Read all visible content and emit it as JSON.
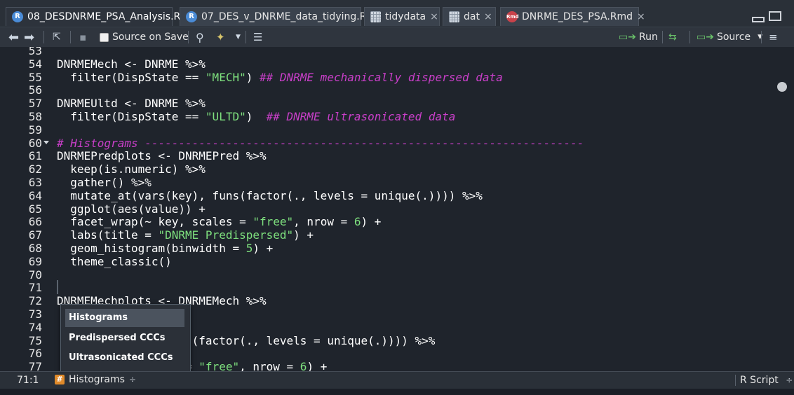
{
  "tabs": [
    {
      "label": "08_DESDNRME_PSA_Analysis.R",
      "icon": "r-script-icon",
      "active": true
    },
    {
      "label": "07_DES_v_DNRME_data_tidying.R",
      "icon": "r-script-icon",
      "active": false
    },
    {
      "label": "tidydata",
      "icon": "data-table-icon",
      "active": false
    },
    {
      "label": "dat",
      "icon": "data-table-icon",
      "active": false
    },
    {
      "label": "DNRME_DES_PSA.Rmd",
      "icon": "rmarkdown-icon",
      "active": false
    }
  ],
  "tab_close_glyph": "×",
  "toolbar": {
    "source_on_save_label": "Source on Save",
    "run_label": "Run",
    "source_label": "Source"
  },
  "editor": {
    "lines": [
      {
        "n": "53",
        "code": ""
      },
      {
        "n": "54",
        "code": "DNRMEMech <- DNRME %>%"
      },
      {
        "n": "55",
        "code": "  filter(DispState == ",
        "str": "\"MECH\"",
        "rest": ") ",
        "cmt": "## DNRME mechanically dispersed data"
      },
      {
        "n": "56",
        "code": ""
      },
      {
        "n": "57",
        "code": "DNRMEUltd <- DNRME %>%"
      },
      {
        "n": "58",
        "code": "  filter(DispState == ",
        "str": "\"ULTD\"",
        "rest": ")  ",
        "cmt": "## DNRME ultrasonicated data"
      },
      {
        "n": "59",
        "code": ""
      },
      {
        "n": "60",
        "code": "",
        "cmt": "# Histograms -----------------------------------------------------------------",
        "fold": true
      },
      {
        "n": "61",
        "code": "DNRMEPredplots <- DNRMEPred %>%"
      },
      {
        "n": "62",
        "code": "  keep(is.numeric) %>%"
      },
      {
        "n": "63",
        "code": "  gather() %>%"
      },
      {
        "n": "64",
        "code": "  mutate_at(vars(key), funs(factor(., levels = unique(.)))) %>%"
      },
      {
        "n": "65",
        "code": "  ggplot(aes(value)) +"
      },
      {
        "n": "66",
        "code": "  facet_wrap(~ key, scales = ",
        "str": "\"free\"",
        "rest": ", nrow = ",
        "num": "6",
        "rest2": ") +"
      },
      {
        "n": "67",
        "code": "  labs(title = ",
        "str": "\"DNRME Predispersed\"",
        "rest": ") +"
      },
      {
        "n": "68",
        "code": "  geom_histogram(binwidth = ",
        "num": "5",
        "rest2": ") +"
      },
      {
        "n": "69",
        "code": "  theme_classic()"
      },
      {
        "n": "70",
        "code": ""
      },
      {
        "n": "71",
        "code": ""
      },
      {
        "n": "72",
        "code": "DNRMEMechplots <- DNRMEMech %>%"
      },
      {
        "n": "73",
        "code": "            %>%"
      },
      {
        "n": "74",
        "code": ""
      },
      {
        "n": "75",
        "code": "            y), funs(factor(., levels = unique(.)))) %>%"
      },
      {
        "n": "76",
        "code": "            ) +"
      },
      {
        "n": "77",
        "code": "            scales = ",
        "str": "\"free\"",
        "rest": ", nrow = ",
        "num": "6",
        "rest2": ") +"
      }
    ]
  },
  "status": {
    "cursor_position": "71:1",
    "scope_label": "Histograms",
    "scope_caret": "÷",
    "file_type": "R Script",
    "file_type_caret": "÷"
  },
  "outline_popup": {
    "items": [
      "Histograms",
      "Predispersed CCCs",
      "Ultrasonicated CCCs"
    ],
    "selected": "Histograms"
  },
  "colors": {
    "string": "#7ee07e",
    "comment": "#c93fc9",
    "background": "#1f242c"
  }
}
